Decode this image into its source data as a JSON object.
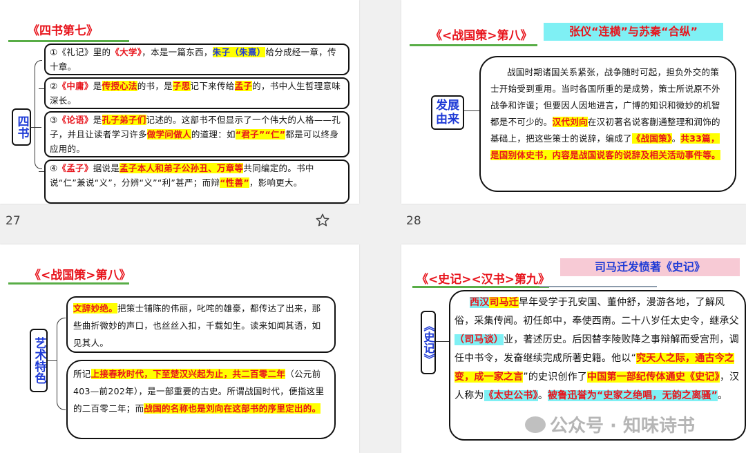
{
  "slides": [
    {
      "number": "27",
      "title": "《四书第七》",
      "side_label": "四书",
      "items": [
        [
          "①《礼记》里的",
          "《大学》",
          "，本是一篇东西，",
          "朱子（朱熹）",
          "给分成经一章，传十章。"
        ],
        [
          "②",
          "《中庸》",
          "是",
          "传授心法",
          "的书，是",
          "子思",
          "记下来传给",
          "孟子",
          "的，书中人生哲理意味深长。"
        ],
        [
          "③",
          "《论语》",
          "是",
          "孔子弟子们",
          "记述的。这部书不但显示了一个伟大的人格——孔子，并且让读者学习许多",
          "做学问做人",
          "的道理：如",
          "“君子”“仁”",
          "都是可以终身应用的。"
        ],
        [
          "④",
          "《孟子》",
          "据说是",
          "孟子本人和弟子公孙丑、万章等",
          "共同编定的。书中说“仁”兼说“义”，分辨“义”“利”甚严；而辩",
          "“性善”",
          "，影响更大。"
        ]
      ]
    },
    {
      "number": "28",
      "title": "《<战国策>第八》",
      "subtitle": "张仪“连横”与苏秦“合纵”",
      "side_label": "发展由来",
      "body": [
        "战国时期诸国关系紧张，战争随时可起，担负外交的策士开始受到重用。当时各国所重的是成势，策士所说原不外战争和诈谖；但要因人因地进言，广博的知识和微妙的机智都是不可少的。",
        "汉代刘向",
        "在汉初著名说客蒯通整理和润饰的基础上，把这些策士的说辞，编成了",
        "《战国策》",
        "。",
        "共33篇，是国别体史书，内容是战国说客的说辞及相关活动事件等。"
      ]
    },
    {
      "title": "《<战国策>第八》",
      "side_label": "艺术特色",
      "box1": [
        "文辞妙绝。",
        "把策士铺陈的伟丽，叱咤的雄豪，都传达了出来，那些曲折微妙的声口，也丝丝入扣，千载如生。读来如闻其语，如见其人。"
      ],
      "box2": [
        "所记",
        "上接春秋时代，下至楚汉兴起为止，共二百零二年",
        "（公元前403—前202年），是一部重要的古史。所谓战国时代，便指这里的二百零二年；而",
        "战国的名称也是刘向在这部书的序里定出的。"
      ]
    },
    {
      "title": "《<史记><汉书>第九》",
      "subtitle": "司马迁发愤著《史记》",
      "side_label": "《史记》",
      "body": [
        "西汉",
        "司马迁",
        "早年受学于孔安国、董仲舒，漫游各地，了解风俗，采集传闻。初任郎中，奉使西南。二十八岁任太史令，继承父",
        "（司马谈）",
        "业，著述历史。后因替李陵败降之事辩解而受宫刑，调任中书令，发奋继续完成所著史籍。他以“",
        "究天人之际，通古今之变，成一家之言",
        "”的史识创作了",
        "中国第一部纪传体通史《史记》",
        "，汉人称为",
        "《太史公书》",
        "。",
        "被鲁迅誉为“史家之绝唱，无韵之离骚”",
        "。"
      ]
    }
  ],
  "watermark": "公众号 · 知味诗书",
  "colors": {
    "red": "#e8141c",
    "blue": "#1f3bd6",
    "yellow": "#ffff00",
    "cyan": "#7ff0f4",
    "green": "#58ad46",
    "pink": "#f7cad5"
  }
}
